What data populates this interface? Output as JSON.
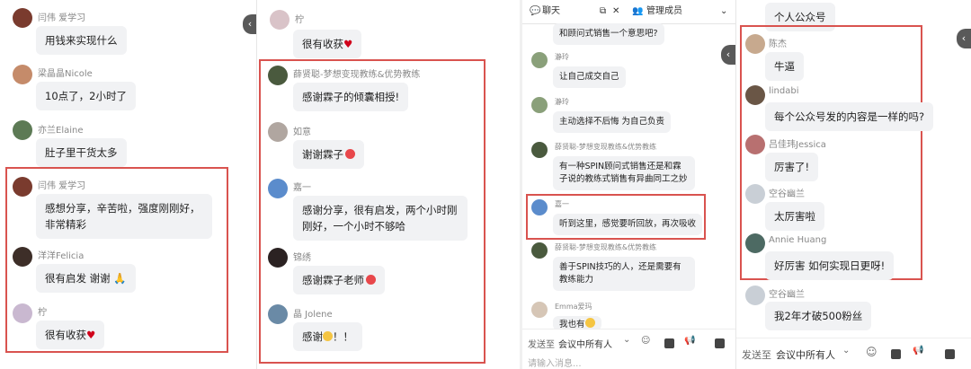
{
  "panel1": {
    "messages": [
      {
        "name": "闫伟 爱学习",
        "text": "用钱来实现什么"
      },
      {
        "name": "梁晶晶Nicole",
        "text": "10点了，2小时了"
      },
      {
        "name": "亦兰Elaine",
        "text": "肚子里干货太多"
      },
      {
        "name": "闫伟 爱学习",
        "text": "感想分享，辛苦啦，强度刚刚好，非常精彩"
      },
      {
        "name": "洋洋Felicia",
        "text": "很有启发 谢谢"
      },
      {
        "name": "柠",
        "text": "很有收获"
      }
    ]
  },
  "panel2": {
    "messages": [
      {
        "name": "柠",
        "text": "很有收获"
      },
      {
        "name": "薛贤聪-梦想变现教练&优势教练",
        "text": "感谢霖子的倾囊相授!"
      },
      {
        "name": "如意",
        "text": "谢谢霖子"
      },
      {
        "name": "嘉一",
        "text": "感谢分享，很有启发，两个小时刚刚好，一个小时不够哈"
      },
      {
        "name": "锦绣",
        "text": "感谢霖子老师"
      },
      {
        "name": "晶 Jolene",
        "text": "感谢"
      },
      {
        "text_suffix": "！！"
      }
    ]
  },
  "panel3": {
    "tabs": {
      "chat": "聊天",
      "manage": "管理成员"
    },
    "messages": [
      {
        "name": "",
        "text": "和顾问式销售一个意思吧?"
      },
      {
        "name": "瀞玲",
        "text": "让自己成交自己"
      },
      {
        "name": "瀞玲",
        "text": "主动选择不后悔 为自己负责"
      },
      {
        "name": "薛贤聪-梦想变现教练&优势教练",
        "text": "有一种SPIN顾问式销售还是和霖子说的教练式销售有异曲同工之妙"
      },
      {
        "name": "嘉一",
        "text": "听到这里，感觉要听回放，再次吸收"
      },
      {
        "name": "薛贤聪-梦想变现教练&优势教练",
        "text": "善于SPIN技巧的人，还是需要有教练能力"
      },
      {
        "name": "Emma爱玛",
        "text": "我也有"
      }
    ],
    "footer": {
      "send_to": "发送至",
      "target": "会议中所有人",
      "placeholder": "请输入消息..."
    }
  },
  "panel4": {
    "messages": [
      {
        "name": "",
        "text": "个人公众号"
      },
      {
        "name": "陈杰",
        "text": "牛逼"
      },
      {
        "name": "lindabi",
        "text": "每个公众号发的内容是一样的吗?"
      },
      {
        "name": "吕佳玮Jessica",
        "text": "厉害了!"
      },
      {
        "name": "空谷幽兰",
        "text": "太厉害啦"
      },
      {
        "name": "Annie Huang",
        "text": "好厉害 如何实现日更呀!"
      },
      {
        "name": "空谷幽兰",
        "text": "我2年才破500粉丝"
      }
    ],
    "footer": {
      "send_to": "发送至",
      "target": "会议中所有人"
    }
  },
  "colors": {
    "highlight": "#d9534f",
    "bubble": "#f1f2f4"
  }
}
